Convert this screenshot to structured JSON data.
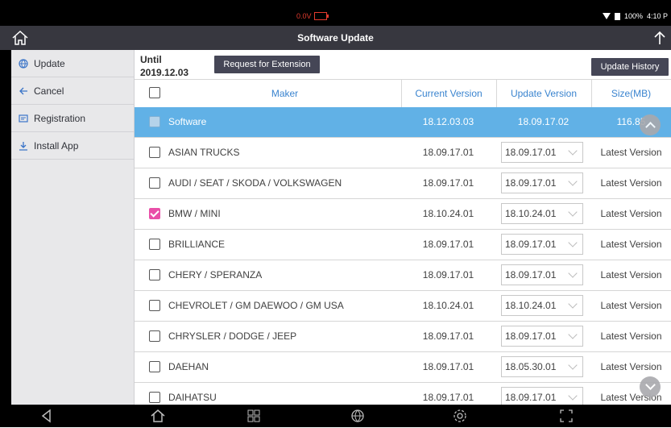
{
  "status_bar": {
    "voltage": "0.0V",
    "battery_pct": "100%",
    "time": "4:10 P"
  },
  "titlebar": {
    "title": "Software Update"
  },
  "sidebar": {
    "items": [
      {
        "label": "Update",
        "icon": "globe-icon"
      },
      {
        "label": "Cancel",
        "icon": "arrow-left-icon"
      },
      {
        "label": "Registration",
        "icon": "registration-icon"
      },
      {
        "label": "Install App",
        "icon": "download-icon"
      }
    ]
  },
  "top": {
    "until_label": "Until",
    "until_date": "2019.12.03",
    "request_button": "Request for Extension",
    "history_button": "Update History"
  },
  "table": {
    "headers": {
      "maker": "Maker",
      "current": "Current Version",
      "update": "Update Version",
      "size": "Size(MB)"
    },
    "rows": [
      {
        "maker": "Software",
        "current": "18.12.03.03",
        "update": "18.09.17.02",
        "size": "116.85",
        "selected": true,
        "checked": false
      },
      {
        "maker": "ASIAN TRUCKS",
        "current": "18.09.17.01",
        "update": "18.09.17.01",
        "size": "Latest Version",
        "checked": false
      },
      {
        "maker": "AUDI / SEAT / SKODA / VOLKSWAGEN",
        "current": "18.09.17.01",
        "update": "18.09.17.01",
        "size": "Latest Version",
        "checked": false
      },
      {
        "maker": "BMW / MINI",
        "current": "18.10.24.01",
        "update": "18.10.24.01",
        "size": "Latest Version",
        "checked": true
      },
      {
        "maker": "BRILLIANCE",
        "current": "18.09.17.01",
        "update": "18.09.17.01",
        "size": "Latest Version",
        "checked": false
      },
      {
        "maker": "CHERY / SPERANZA",
        "current": "18.09.17.01",
        "update": "18.09.17.01",
        "size": "Latest Version",
        "checked": false
      },
      {
        "maker": "CHEVROLET / GM DAEWOO / GM USA",
        "current": "18.10.24.01",
        "update": "18.10.24.01",
        "size": "Latest Version",
        "checked": false
      },
      {
        "maker": "CHRYSLER / DODGE / JEEP",
        "current": "18.09.17.01",
        "update": "18.09.17.01",
        "size": "Latest Version",
        "checked": false
      },
      {
        "maker": "DAEHAN",
        "current": "18.09.17.01",
        "update": "18.05.30.01",
        "size": "Latest Version",
        "checked": false
      },
      {
        "maker": "DAIHATSU",
        "current": "18.09.17.01",
        "update": "18.09.17.01",
        "size": "Latest Version",
        "checked": false
      }
    ]
  },
  "colors": {
    "accent": "#3a84cf",
    "selected_row": "#61b1e6",
    "checkbox_checked": "#e94fa8",
    "titlebar": "#37373f",
    "button": "#454656"
  }
}
